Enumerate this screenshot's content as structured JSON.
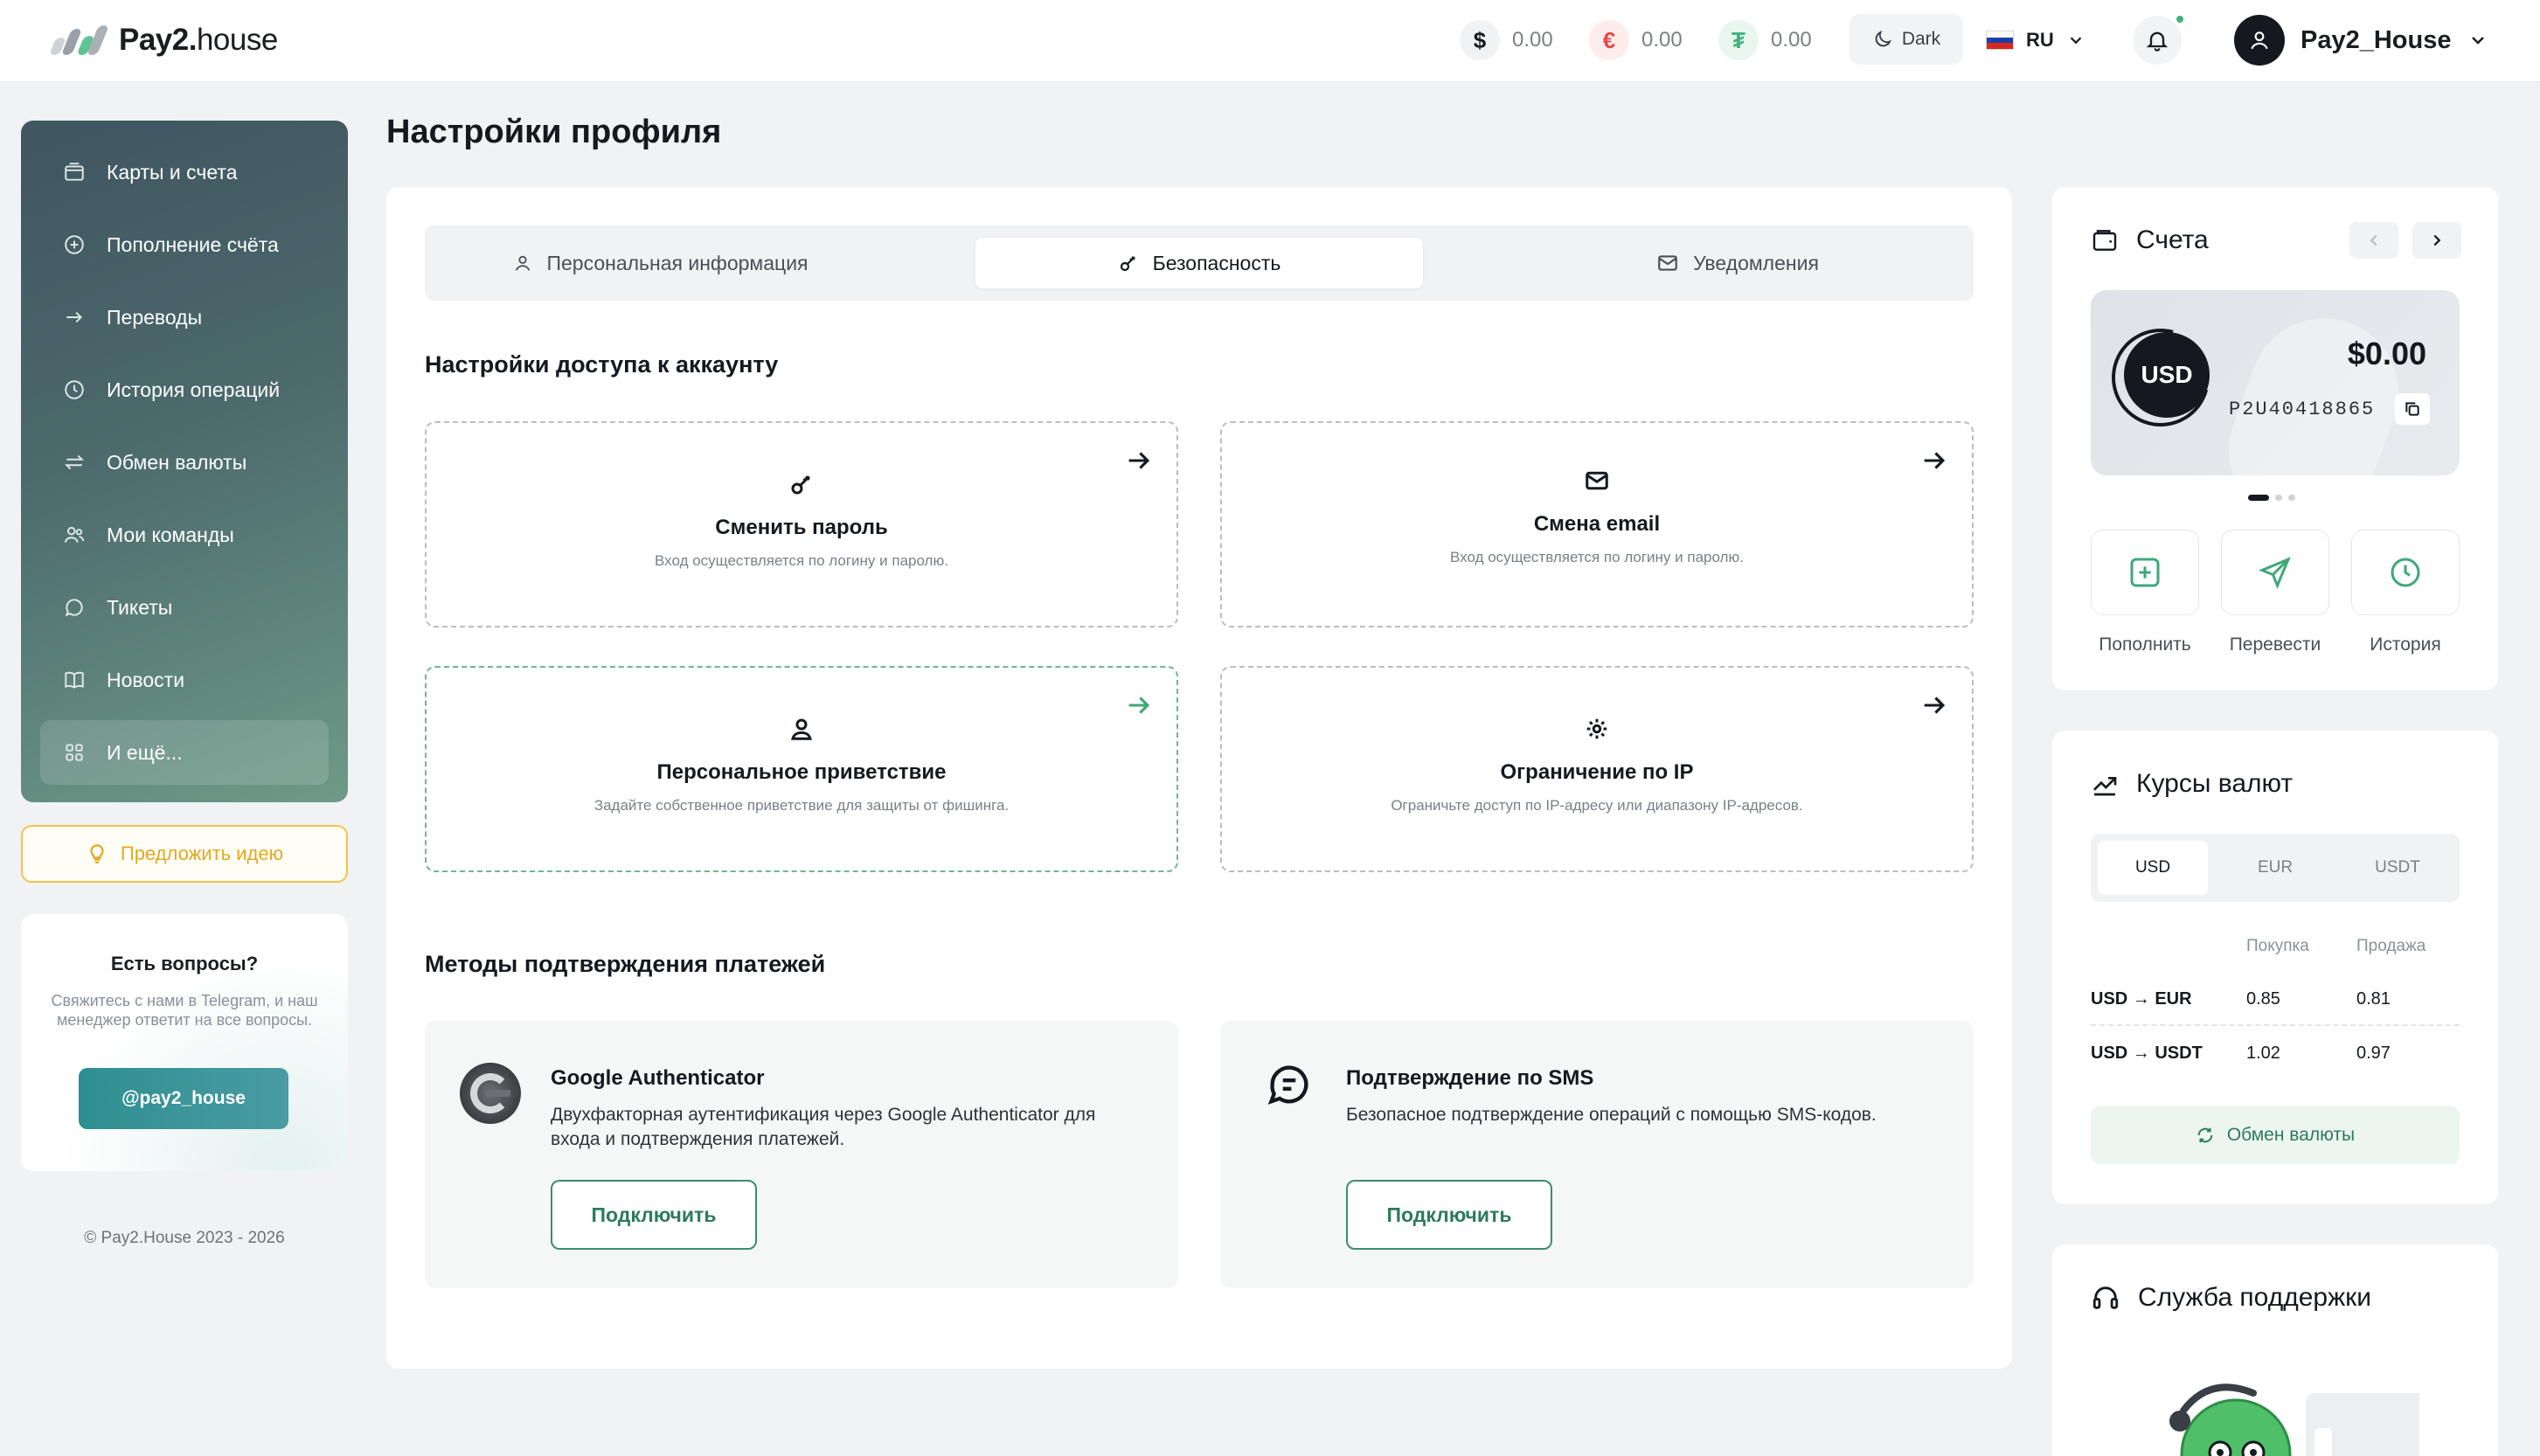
{
  "header": {
    "logo_bold": "Pay2.",
    "logo_thin": "house",
    "balances": [
      {
        "symbol": "$",
        "value": "0.00",
        "color": "#15191f",
        "bg": "#f1f2f4"
      },
      {
        "symbol": "€",
        "value": "0.00",
        "color": "#e14b4b",
        "bg": "#fdecec"
      },
      {
        "symbol": "₮",
        "value": "0.00",
        "color": "#3fb27f",
        "bg": "#e9f6f0"
      }
    ],
    "theme_label": "Dark",
    "language": "RU",
    "user_name": "Pay2_House"
  },
  "sidebar": {
    "items": [
      {
        "label": "Карты и счета",
        "icon": "wallet-icon"
      },
      {
        "label": "Пополнение счёта",
        "icon": "plus-circle-icon"
      },
      {
        "label": "Переводы",
        "icon": "arrow-right-icon"
      },
      {
        "label": "История операций",
        "icon": "clock-icon"
      },
      {
        "label": "Обмен валюты",
        "icon": "exchange-icon"
      },
      {
        "label": "Мои команды",
        "icon": "users-icon"
      },
      {
        "label": "Тикеты",
        "icon": "chat-icon"
      },
      {
        "label": "Новости",
        "icon": "book-icon"
      },
      {
        "label": "И ещё...",
        "icon": "grid-icon"
      }
    ],
    "idea_label": "Предложить идею",
    "help": {
      "title": "Есть вопросы?",
      "text": "Свяжитесь с нами в Telegram, и наш менеджер ответит на все вопросы.",
      "button": "@pay2_house"
    },
    "copyright": "© Pay2.House 2023 - 2026"
  },
  "main": {
    "title": "Настройки профиля",
    "tabs": [
      {
        "label": "Персональная информация",
        "icon": "user-icon"
      },
      {
        "label": "Безопасность",
        "icon": "key-icon"
      },
      {
        "label": "Уведомления",
        "icon": "mail-icon"
      }
    ],
    "access_title": "Настройки доступа к аккаунту",
    "access_cards": [
      {
        "title": "Сменить пароль",
        "desc": "Вход осуществляется по логину и паролю.",
        "icon": "key-icon"
      },
      {
        "title": "Смена email",
        "desc": "Вход осуществляется по логину и паролю.",
        "icon": "mail-icon"
      },
      {
        "title": "Персональное приветствие",
        "desc": "Задайте собственное приветствие для защиты от фишинга.",
        "icon": "user-icon"
      },
      {
        "title": "Ограничение по IP",
        "desc": "Ограничьте доступ по IP-адресу или диапазону IP-адресов.",
        "icon": "gear-icon"
      }
    ],
    "methods_title": "Методы подтверждения платежей",
    "methods": [
      {
        "title": "Google Authenticator",
        "desc": "Двухфакторная аутентификация через Google Authenticator для входа и подтверждения платежей.",
        "button": "Подключить"
      },
      {
        "title": "Подтверждение по SMS",
        "desc": "Безопасное подтверждение операций с помощью SMS-кодов.",
        "button": "Подключить"
      }
    ]
  },
  "accounts": {
    "title": "Счета",
    "currency": "USD",
    "amount": "$0.00",
    "number": "P2U40418865",
    "actions": [
      {
        "label": "Пополнить",
        "icon": "plus-square-icon"
      },
      {
        "label": "Перевести",
        "icon": "send-icon"
      },
      {
        "label": "История",
        "icon": "clock-icon"
      }
    ]
  },
  "rates": {
    "title": "Курсы валют",
    "tabs": [
      "USD",
      "EUR",
      "USDT"
    ],
    "col_buy": "Покупка",
    "col_sell": "Продажа",
    "rows": [
      {
        "pair": "USD → EUR",
        "buy": "0.85",
        "sell": "0.81"
      },
      {
        "pair": "USD → USDT",
        "buy": "1.02",
        "sell": "0.97"
      }
    ],
    "exchange_button": "Обмен валюты"
  },
  "support": {
    "title": "Служба поддержки"
  }
}
